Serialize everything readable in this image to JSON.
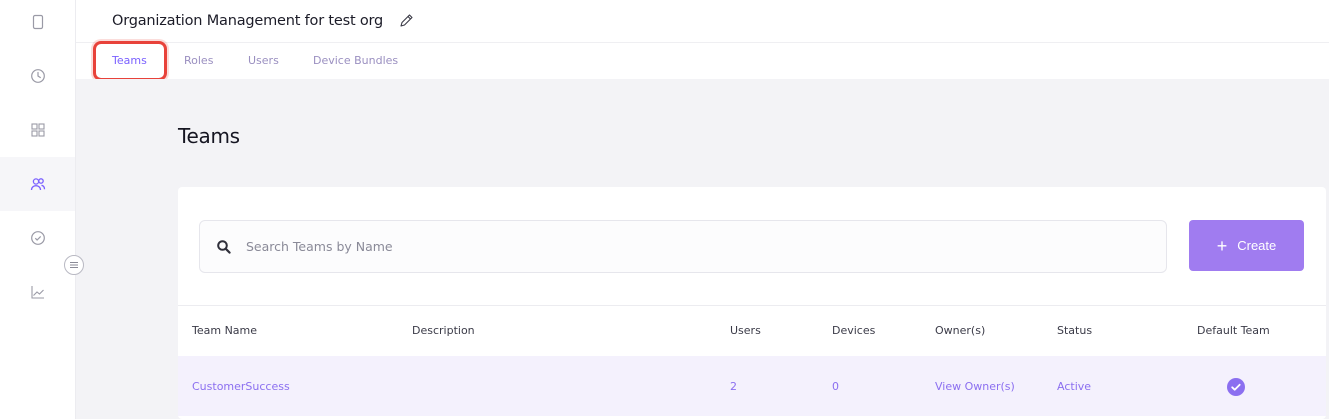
{
  "header": {
    "title": "Organization Management for test org"
  },
  "tabs": [
    {
      "label": "Teams",
      "active": true
    },
    {
      "label": "Roles",
      "active": false
    },
    {
      "label": "Users",
      "active": false
    },
    {
      "label": "Device Bundles",
      "active": false
    }
  ],
  "sidebar": {
    "items": [
      {
        "icon": "device-icon"
      },
      {
        "icon": "clock-icon"
      },
      {
        "icon": "grid-icon"
      },
      {
        "icon": "users-icon",
        "active": true
      },
      {
        "icon": "check-circle-icon"
      },
      {
        "icon": "chart-line-icon"
      }
    ]
  },
  "main": {
    "section_title": "Teams",
    "search": {
      "placeholder": "Search Teams by Name",
      "value": ""
    },
    "create_label": "Create",
    "columns": [
      "Team Name",
      "Description",
      "Users",
      "Devices",
      "Owner(s)",
      "Status",
      "Default Team"
    ],
    "rows": [
      {
        "team_name": "CustomerSuccess",
        "description": "",
        "users": "2",
        "devices": "0",
        "owners": "View Owner(s)",
        "status": "Active",
        "default_team": true
      }
    ]
  },
  "colors": {
    "accent": "#7b61ff",
    "button": "#a07cf0",
    "highlight": "#e8423a",
    "row_bg": "#f4f1fd"
  }
}
